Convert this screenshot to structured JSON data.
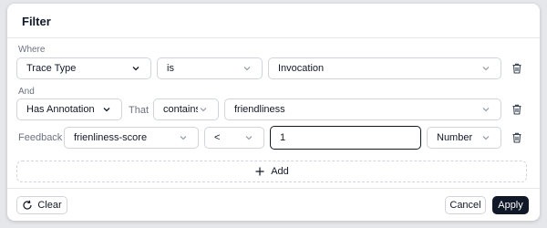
{
  "dialog": {
    "title": "Filter"
  },
  "where": {
    "label": "Where",
    "field": "Trace Type",
    "operator": "is",
    "value": "Invocation"
  },
  "and": {
    "label": "And",
    "field": "Has Annotation",
    "connector": "That",
    "operator": "contains",
    "value": "friendliness"
  },
  "feedback": {
    "label": "Feedback",
    "field": "frienliness-score",
    "operator": "<",
    "value": "1",
    "type": "Number"
  },
  "add": {
    "label": "Add"
  },
  "footer": {
    "clear_label": "Clear",
    "cancel_label": "Cancel",
    "apply_label": "Apply"
  },
  "icons": {
    "chevron": "chevron-down-icon",
    "trash": "trash-icon",
    "plus": "plus-icon",
    "refresh": "refresh-icon"
  },
  "colors": {
    "primary": "#111827",
    "border": "#d1d5db",
    "muted": "#6b7280"
  }
}
